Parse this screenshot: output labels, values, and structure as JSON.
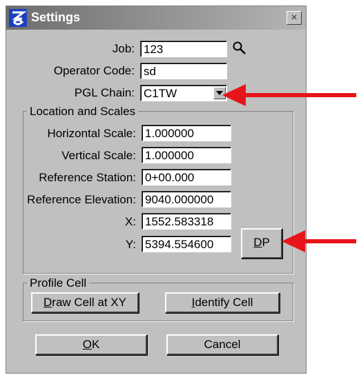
{
  "window": {
    "title": "Settings",
    "close_symbol": "×"
  },
  "fields": {
    "job": {
      "label": "Job:",
      "value": "123"
    },
    "operator_code": {
      "label": "Operator Code:",
      "value": "sd"
    },
    "pgl_chain": {
      "label": "PGL Chain:",
      "value": "C1TW"
    }
  },
  "location_scales": {
    "title": "Location and Scales",
    "horizontal_scale": {
      "label": "Horizontal Scale:",
      "value": "1.000000"
    },
    "vertical_scale": {
      "label": "Vertical Scale:",
      "value": "1.000000"
    },
    "reference_station": {
      "label": "Reference Station:",
      "value": "0+00.000"
    },
    "reference_elevation": {
      "label": "Reference Elevation:",
      "value": "9040.000000"
    },
    "x": {
      "label": "X:",
      "value": "1552.583318"
    },
    "y": {
      "label": "Y:",
      "value": "5394.554600"
    },
    "dp_button": {
      "mnemonic": "D",
      "rest": "P"
    }
  },
  "profile_cell": {
    "title": "Profile Cell",
    "draw_button": {
      "mnemonic": "D",
      "rest": "raw Cell at XY"
    },
    "identify_button": {
      "mnemonic": "I",
      "rest": "dentify Cell"
    }
  },
  "buttons": {
    "ok": {
      "mnemonic": "O",
      "rest": "K"
    },
    "cancel": {
      "label": "Cancel"
    }
  },
  "colors": {
    "annotation_arrow": "#e8141b",
    "titlebar": "#808080",
    "dialog": "#c0c0c0"
  },
  "icons": [
    "app-logo-icon",
    "search-icon",
    "dropdown-arrow-icon",
    "close-icon"
  ]
}
